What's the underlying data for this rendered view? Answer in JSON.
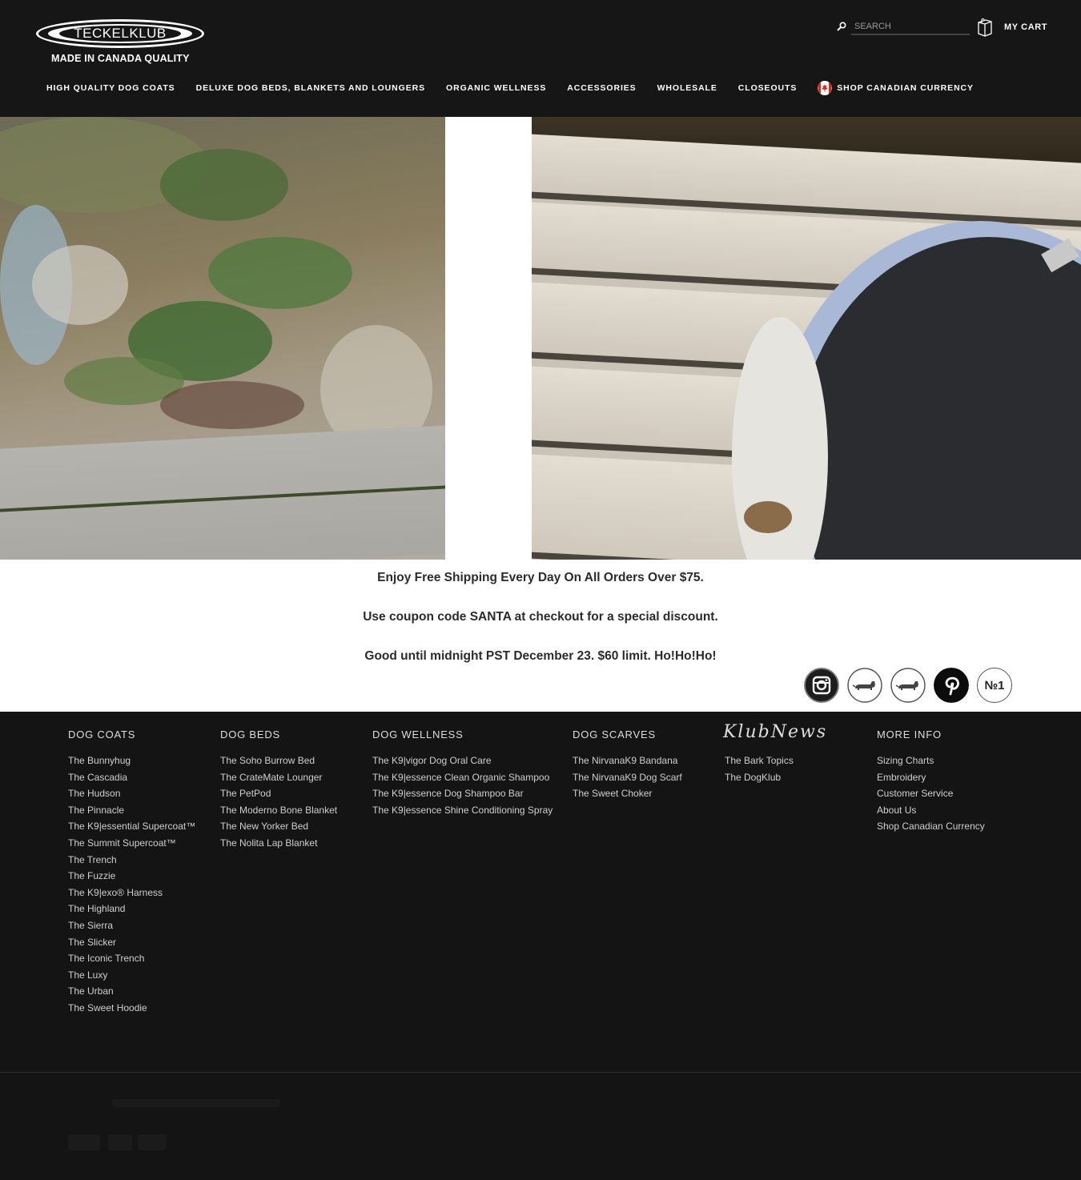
{
  "header": {
    "logo_text": "TECKELKLUB",
    "logo_tagline": "MADE IN CANADA QUALITY",
    "search_placeholder": "SEARCH",
    "cart_label": "MY CART"
  },
  "nav": {
    "items": [
      "HIGH QUALITY DOG COATS",
      "DELUXE DOG BEDS, BLANKETS AND LOUNGERS",
      "ORGANIC WELLNESS",
      "ACCESSORIES",
      "WHOLESALE",
      "CLOSEOUTS",
      "SHOP CANADIAN CURRENCY"
    ]
  },
  "promo": {
    "line1": "Enjoy Free Shipping Every Day On All Orders Over $75.",
    "line2": "Use coupon code SANTA at checkout for a special discount.",
    "line3": "Good until midnight PST December 23. $60 limit. Ho!Ho!Ho!"
  },
  "social": {
    "icons": [
      "instagram-icon",
      "dachshund-icon",
      "dachshund-icon",
      "pinterest-icon",
      "my-dog-is-no1-icon"
    ],
    "badge_text": "№1"
  },
  "footer": {
    "dog_coats": {
      "heading": "DOG COATS",
      "links": [
        "The Bunnyhug",
        "The Cascadia",
        "The Hudson",
        "The Pinnacle",
        "The K9|essential Supercoat™",
        "The Summit Supercoat™",
        "The Trench",
        "The Fuzzie",
        "The K9|exo® Harness",
        "The Highland",
        "The Sierra",
        "The Slicker",
        "The Iconic Trench",
        "The Luxy",
        "The Urban",
        "The Sweet Hoodie"
      ]
    },
    "dog_beds": {
      "heading": "DOG BEDS",
      "links": [
        "The Soho Burrow Bed",
        "The CrateMate Lounger",
        "The PetPod",
        "The Moderno Bone Blanket",
        "The New Yorker Bed",
        "The Nolita Lap Blanket"
      ]
    },
    "dog_wellness": {
      "heading": "DOG WELLNESS",
      "links": [
        "The K9|vigor Dog Oral Care",
        "The K9|essence Clean Organic Shampoo",
        "The K9|essence Dog Shampoo Bar",
        "The K9|essence Shine Conditioning Spray"
      ]
    },
    "dog_scarves": {
      "heading": "DOG SCARVES",
      "links": [
        "The NirvanaK9 Bandana",
        "The NirvanaK9 Dog Scarf",
        "The Sweet Choker"
      ]
    },
    "klub_news": {
      "heading": "KlubNews",
      "links": [
        "The Bark Topics",
        "The DogKlub"
      ]
    },
    "more_info": {
      "heading": "MORE INFO",
      "links": [
        "Sizing Charts",
        "Embroidery",
        "Customer Service",
        "About Us",
        "Shop Canadian Currency"
      ]
    }
  },
  "colors": {
    "header_bg": "#161616",
    "footer_bg": "#141414",
    "promo_text": "#2b2b2b"
  }
}
